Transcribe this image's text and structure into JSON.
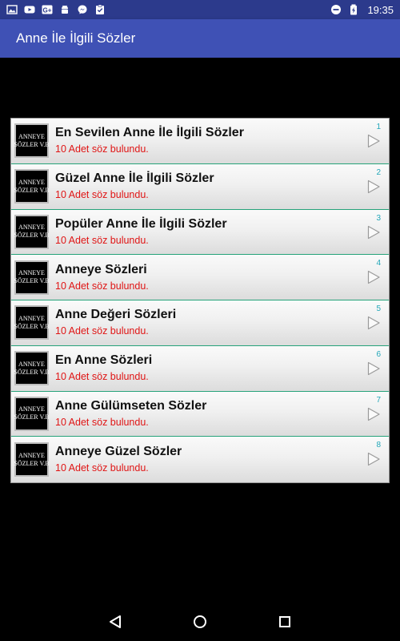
{
  "status_bar": {
    "left_icons": [
      "image-icon",
      "youtube-icon",
      "google-plus-icon",
      "android-icon",
      "messenger-icon",
      "clipboard-check-icon"
    ],
    "right_icons": [
      "do-not-disturb-icon",
      "battery-charging-icon"
    ],
    "time": "19:35"
  },
  "app_bar": {
    "title": "Anne İle İlgili Sözler"
  },
  "thumbnail": {
    "line1": "ANNEYE",
    "line2": "SÖZLER V.B"
  },
  "list": {
    "items": [
      {
        "title": "En Sevilen Anne İle İlgili Sözler",
        "subtitle": "10 Adet söz bulundu.",
        "number": "1"
      },
      {
        "title": "Güzel Anne İle İlgili Sözler",
        "subtitle": "10 Adet söz bulundu.",
        "number": "2"
      },
      {
        "title": "Popüler Anne İle İlgili Sözler",
        "subtitle": "10 Adet söz bulundu.",
        "number": "3"
      },
      {
        "title": "Anneye Sözleri",
        "subtitle": "10 Adet söz bulundu.",
        "number": "4"
      },
      {
        "title": "Anne Değeri Sözleri",
        "subtitle": "10 Adet söz bulundu.",
        "number": "5"
      },
      {
        "title": "En Anne Sözleri",
        "subtitle": "10 Adet söz bulundu.",
        "number": "6"
      },
      {
        "title": "Anne Gülümseten Sözler",
        "subtitle": "10 Adet söz bulundu.",
        "number": "7"
      },
      {
        "title": "Anneye Güzel Sözler",
        "subtitle": "10 Adet söz bulundu.",
        "number": "8"
      }
    ]
  },
  "nav_bar": {
    "buttons": [
      "back-icon",
      "home-icon",
      "recents-icon"
    ]
  },
  "colors": {
    "status_bar": "#2c3a8c",
    "app_bar": "#3f51b5",
    "background": "#000000",
    "subtitle": "#e01515",
    "number": "#22a6b8",
    "divider": "#27a37a"
  }
}
